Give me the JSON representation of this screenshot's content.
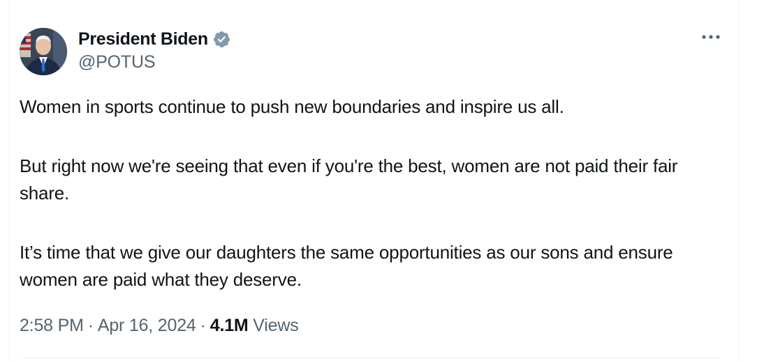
{
  "author": {
    "display_name": "President Biden",
    "handle": "@POTUS",
    "verified": true
  },
  "tweet": {
    "paragraphs": [
      "Women in sports continue to push new boundaries and inspire us all.",
      "But right now we're seeing that even if you're the best, women are not paid their fair share.",
      "It’s time that we give our daughters the same opportunities as our sons and ensure women are paid what they deserve."
    ]
  },
  "meta": {
    "time": "2:58 PM",
    "separator": "·",
    "date": "Apr 16, 2024",
    "views_count": "4.1M",
    "views_label": "Views"
  },
  "icons": {
    "verified": "verified-badge-icon",
    "more": "more-horizontal-icon"
  },
  "colors": {
    "text_primary": "#0f1419",
    "text_secondary": "#536471",
    "verified_badge": "#829aab",
    "border": "#eff3f4"
  }
}
